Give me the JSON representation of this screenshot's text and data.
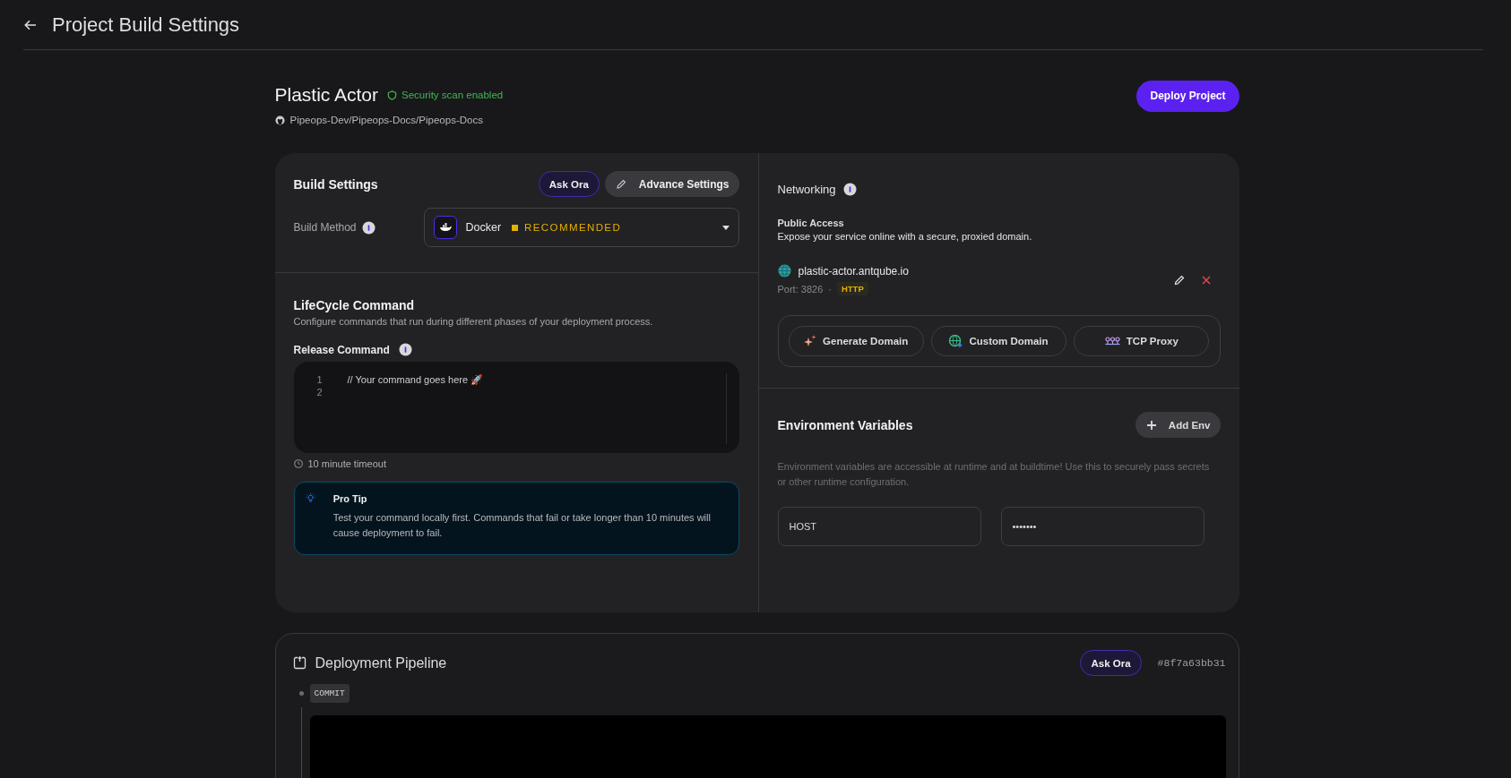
{
  "header": {
    "title": "Project Build Settings"
  },
  "project": {
    "name": "Plastic Actor",
    "security_badge": "Security scan enabled",
    "repo": "Pipeops-Dev/Pipeops-Docs/Pipeops-Docs",
    "deploy_button": "Deploy Project"
  },
  "build_settings": {
    "title": "Build Settings",
    "ask_button": "Ask Ora",
    "advance_button": "Advance Settings",
    "build_method_label": "Build Method",
    "build_method": {
      "value": "Docker",
      "tag": "RECOMMENDED"
    }
  },
  "lifecycle": {
    "title": "LifeCycle Command",
    "description": "Configure commands that run during different phases of your deployment process.",
    "release_label": "Release Command",
    "editor": {
      "line_numbers": [
        "1",
        "2"
      ],
      "lines": [
        "// Your command goes here 🚀"
      ]
    },
    "timeout": "10 minute timeout",
    "tip": {
      "title": "Pro Tip",
      "text": "Test your command locally first. Commands that fail or take longer than 10 minutes will cause deployment to fail."
    }
  },
  "networking": {
    "title": "Networking",
    "public_access_title": "Public Access",
    "public_access_text": "Expose your service online with a secure, proxied domain.",
    "domain": {
      "host": "plastic-actor.antqube.io",
      "port": "Port: 3826",
      "separator": "·",
      "protocol": "HTTP"
    },
    "actions": [
      {
        "kind": "generate",
        "label": "Generate Domain"
      },
      {
        "kind": "custom",
        "label": "Custom Domain"
      },
      {
        "kind": "tcp",
        "label": "TCP Proxy"
      }
    ]
  },
  "environment": {
    "title": "Environment Variables",
    "add_button": "Add Env",
    "description": "Environment variables are accessible at runtime and at buildtime! Use this to securely pass secrets or other runtime configuration.",
    "variables": [
      {
        "key": "HOST",
        "value": "•••••••"
      }
    ]
  },
  "pipeline": {
    "title": "Deployment Pipeline",
    "ask_button": "Ask Ora",
    "commit_hash": "#8f7a63bb31",
    "steps": [
      {
        "label": "COMMIT"
      }
    ]
  }
}
